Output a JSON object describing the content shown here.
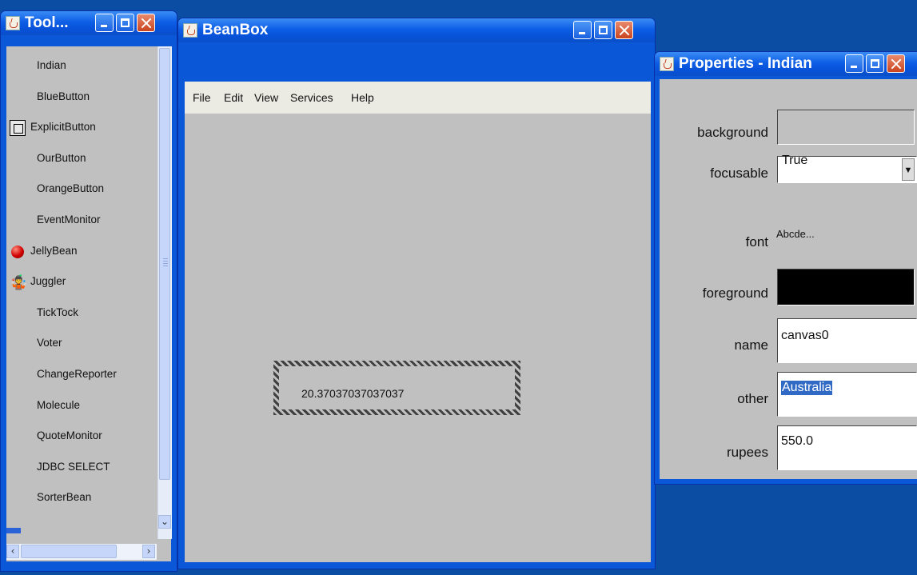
{
  "toolbox": {
    "title": "Tool...",
    "items": [
      {
        "label": "Indian",
        "icon": ""
      },
      {
        "label": "BlueButton",
        "icon": ""
      },
      {
        "label": "ExplicitButton",
        "icon": "explicit-button-icon"
      },
      {
        "label": "OurButton",
        "icon": ""
      },
      {
        "label": "OrangeButton",
        "icon": ""
      },
      {
        "label": "EventMonitor",
        "icon": ""
      },
      {
        "label": "JellyBean",
        "icon": "jellybean-icon"
      },
      {
        "label": "Juggler",
        "icon": "juggler-icon"
      },
      {
        "label": "TickTock",
        "icon": ""
      },
      {
        "label": "Voter",
        "icon": ""
      },
      {
        "label": "ChangeReporter",
        "icon": ""
      },
      {
        "label": "Molecule",
        "icon": ""
      },
      {
        "label": "QuoteMonitor",
        "icon": ""
      },
      {
        "label": "JDBC SELECT",
        "icon": ""
      },
      {
        "label": "SorterBean",
        "icon": ""
      }
    ]
  },
  "beanbox": {
    "title": "BeanBox",
    "menu": [
      "File",
      "Edit",
      "View",
      "Services",
      "Help"
    ],
    "bean_value": "20.37037037037037"
  },
  "properties": {
    "title": "Properties - Indian",
    "rows": {
      "background": {
        "label": "background",
        "color": "#c0c0c0"
      },
      "focusable": {
        "label": "focusable",
        "value": "True"
      },
      "font": {
        "label": "font",
        "value": "Abcde..."
      },
      "foreground": {
        "label": "foreground",
        "color": "#000000"
      },
      "name": {
        "label": "name",
        "value": "canvas0"
      },
      "other": {
        "label": "other",
        "value": "Australia"
      },
      "rupees": {
        "label": "rupees",
        "value": "550.0"
      }
    }
  },
  "colors": {
    "desktop": "#0a4da3",
    "titlebar": "#0e5ee6",
    "client": "#c0c0c0",
    "selection": "#316ac5"
  }
}
